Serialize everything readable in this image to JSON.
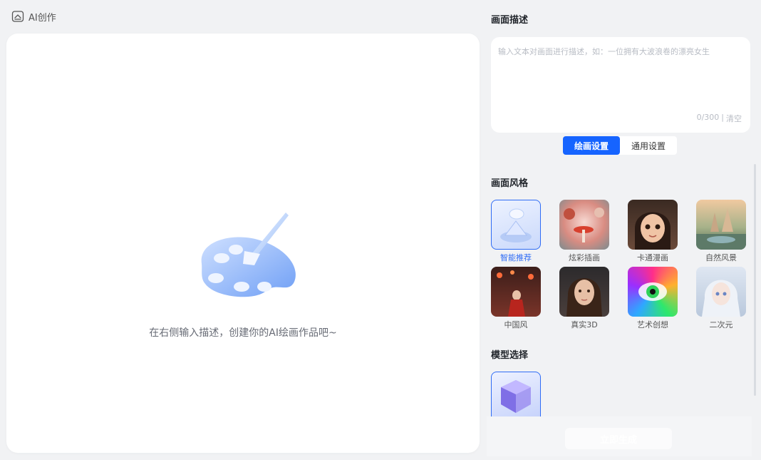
{
  "header": {
    "title": "AI创作",
    "icon": "home-icon"
  },
  "canvas": {
    "empty_hint": "在右侧输入描述，创建你的AI绘画作品吧~",
    "illustration": "palette-icon"
  },
  "description": {
    "title": "画面描述",
    "placeholder": "输入文本对画面进行描述，如：一位拥有大波浪卷的漂亮女生",
    "value": "",
    "counter": "0/300",
    "separator": "|",
    "clear_label": "清空"
  },
  "tabs": [
    {
      "label": "绘画设置",
      "active": true
    },
    {
      "label": "通用设置",
      "active": false
    }
  ],
  "style_section": {
    "title": "画面风格",
    "items": [
      {
        "label": "智能推荐",
        "selected": true
      },
      {
        "label": "炫彩插画",
        "selected": false
      },
      {
        "label": "卡通漫画",
        "selected": false
      },
      {
        "label": "自然风景",
        "selected": false
      },
      {
        "label": "中国风",
        "selected": false
      },
      {
        "label": "真实3D",
        "selected": false
      },
      {
        "label": "艺术创想",
        "selected": false
      },
      {
        "label": "二次元",
        "selected": false
      }
    ]
  },
  "model_section": {
    "title": "模型选择"
  },
  "generate": {
    "label": "立即生成"
  },
  "colors": {
    "accent": "#1664ff",
    "background": "#f1f2f4",
    "card": "#ffffff"
  }
}
